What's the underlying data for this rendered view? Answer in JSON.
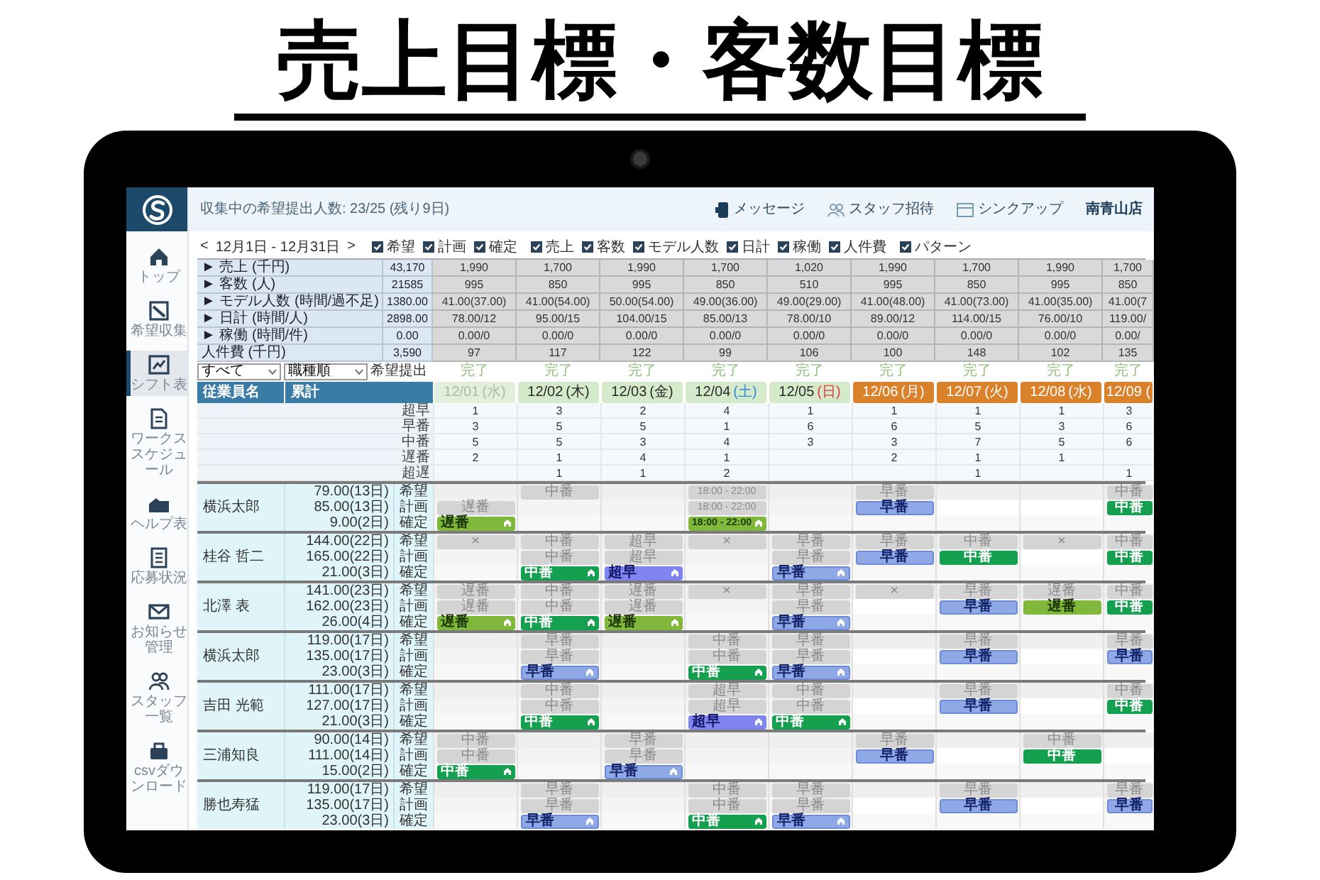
{
  "headline": "売上目標・客数目標",
  "header": {
    "status": "収集中の希望提出人数: 23/25 (残り9日)",
    "links": [
      "メッセージ",
      "スタッフ招待",
      "シンクアップ"
    ],
    "store": "南青山店"
  },
  "sidebar": {
    "items": [
      {
        "label": "トップ",
        "selected": false
      },
      {
        "label": "希望収集",
        "selected": false
      },
      {
        "label": "シフト表",
        "selected": true
      },
      {
        "label": "ワークススケジュール",
        "selected": false
      },
      {
        "label": "ヘルプ表",
        "selected": false
      },
      {
        "label": "応募状況",
        "selected": false
      },
      {
        "label": "お知らせ管理",
        "selected": false
      },
      {
        "label": "スタッフ一覧",
        "selected": false
      },
      {
        "label": "csvダウンロード",
        "selected": false
      }
    ]
  },
  "date_nav": {
    "prev": "<",
    "range": "12月1日 - 12月31日",
    "next": ">"
  },
  "toggles": [
    {
      "label": "希望",
      "checked": true
    },
    {
      "label": "計画",
      "checked": true
    },
    {
      "label": "確定",
      "checked": true
    },
    {
      "label": "売上",
      "checked": true
    },
    {
      "label": "客数",
      "checked": true
    },
    {
      "label": "モデル人数",
      "checked": true
    },
    {
      "label": "日計",
      "checked": true
    },
    {
      "label": "稼働",
      "checked": true
    },
    {
      "label": "人件費",
      "checked": true
    },
    {
      "label": "パターン",
      "checked": true
    }
  ],
  "summary": [
    {
      "label": "► 売上 (千円)",
      "total": "43,170",
      "values": [
        "1,990",
        "1,700",
        "1,990",
        "1,700",
        "1,020",
        "1,990",
        "1,700",
        "1,990",
        "1,700"
      ]
    },
    {
      "label": "► 客数 (人)",
      "total": "21585",
      "values": [
        "995",
        "850",
        "995",
        "850",
        "510",
        "995",
        "850",
        "995",
        "850"
      ]
    },
    {
      "label": "► モデル人数 (時間/過不足)",
      "total": "1380.00",
      "values": [
        "41.00(37.00)",
        "41.00(54.00)",
        "50.00(54.00)",
        "49.00(36.00)",
        "49.00(29.00)",
        "41.00(48.00)",
        "41.00(73.00)",
        "41.00(35.00)",
        "41.00(7"
      ]
    },
    {
      "label": "► 日計 (時間/人)",
      "total": "2898.00",
      "values": [
        "78.00/12",
        "95.00/15",
        "104.00/15",
        "85.00/13",
        "78.00/10",
        "89.00/12",
        "114.00/15",
        "76.00/10",
        "119.00/"
      ]
    },
    {
      "label": "► 稼働 (時間/件)",
      "total": "0.00",
      "values": [
        "0.00/0",
        "0.00/0",
        "0.00/0",
        "0.00/0",
        "0.00/0",
        "0.00/0",
        "0.00/0",
        "0.00/0",
        "0.00/"
      ]
    },
    {
      "label": "人件費 (千円)",
      "total": "3,590",
      "values": [
        "97",
        "117",
        "122",
        "99",
        "106",
        "100",
        "148",
        "102",
        "135"
      ]
    }
  ],
  "filters": {
    "selects": [
      "すべて",
      "職種順"
    ],
    "label": "希望提出"
  },
  "columns": [
    {
      "date": "12/01",
      "weekday": "(水)",
      "kind": "past",
      "status": "完了"
    },
    {
      "date": "12/02",
      "weekday": "(木)",
      "kind": "upcoming",
      "status": "完了"
    },
    {
      "date": "12/03",
      "weekday": "(金)",
      "kind": "upcoming",
      "status": "完了"
    },
    {
      "date": "12/04",
      "weekday": "(土)",
      "color": "#2b8ad8",
      "kind": "upcoming",
      "status": "完了"
    },
    {
      "date": "12/05",
      "weekday": "(日)",
      "color": "#e23b3b",
      "kind": "upcoming",
      "status": "完了"
    },
    {
      "date": "12/06",
      "weekday": "(月)",
      "kind": "open",
      "status": "完了"
    },
    {
      "date": "12/07",
      "weekday": "(火)",
      "kind": "open",
      "status": "完了"
    },
    {
      "date": "12/08",
      "weekday": "(水)",
      "kind": "open",
      "status": "完了"
    },
    {
      "date": "12/09 (",
      "kind": "open",
      "status": "完了"
    }
  ],
  "table_header": {
    "name": "従業員名",
    "total": "累計"
  },
  "shift_counts": [
    {
      "label": "超早",
      "values": [
        {
          "value": "1"
        },
        {
          "value": "3"
        },
        {
          "value": "2"
        },
        {
          "value": "4"
        },
        {
          "value": "1"
        },
        {
          "value": "1"
        },
        {
          "value": "1"
        },
        {
          "value": "1"
        },
        {
          "value": "3"
        }
      ]
    },
    {
      "label": "早番",
      "values": [
        {
          "value": "3"
        },
        {
          "value": "5"
        },
        {
          "value": "5"
        },
        {
          "value": "1"
        },
        {
          "value": "6"
        },
        {
          "value": "6"
        },
        {
          "value": "5"
        },
        {
          "value": "3"
        },
        {
          "value": "6"
        }
      ]
    },
    {
      "label": "中番",
      "values": [
        {
          "value": "5"
        },
        {
          "value": "5"
        },
        {
          "value": "3"
        },
        {
          "value": "4"
        },
        {
          "value": "3"
        },
        {
          "value": "3"
        },
        {
          "value": "7"
        },
        {
          "value": "5"
        },
        {
          "value": "6"
        }
      ]
    },
    {
      "label": "遅番",
      "values": [
        {
          "value": "2"
        },
        {
          "value": "1"
        },
        {
          "value": "4"
        },
        {
          "value": "1"
        },
        {
          "kind": "empty"
        },
        {
          "value": "2"
        },
        {
          "value": "1"
        },
        {
          "value": "1"
        },
        {
          "kind": "empty"
        }
      ]
    },
    {
      "label": "超遅",
      "values": [
        {
          "kind": "empty"
        },
        {
          "value": "1"
        },
        {
          "value": "1"
        },
        {
          "value": "2"
        },
        {
          "kind": "empty"
        },
        {
          "kind": "empty"
        },
        {
          "value": "1"
        },
        {
          "kind": "empty"
        },
        {
          "value": "1"
        }
      ]
    }
  ],
  "staff": [
    {
      "name": "横浜太郎",
      "rows": [
        {
          "label": "希望",
          "total": "79.00(13日)"
        },
        {
          "label": "計画",
          "total": "85.00(13日)"
        },
        {
          "label": "確定",
          "total": "9.00(2日)"
        }
      ],
      "days": [
        {
          "plan": {
            "kind": "gray",
            "label": "遅番"
          },
          "confirmed": {
            "kind": "olive",
            "label": "遅番"
          }
        },
        {
          "request": {
            "kind": "gray",
            "label": "中番"
          }
        },
        {
          "kind": "empty"
        },
        {
          "request": {
            "kind": "gray",
            "label": "18:00 - 22:00"
          },
          "plan": {
            "kind": "gray",
            "label": "18:00 - 22:00"
          },
          "confirmed": {
            "kind": "olive",
            "label": "18:00 - 22:00"
          }
        },
        {
          "kind": "empty"
        },
        {
          "request": {
            "kind": "gray",
            "label": "早番"
          },
          "plan": {
            "kind": "blue",
            "label": "早番"
          }
        },
        {
          "plan": {
            "kind": "blank"
          }
        },
        {
          "plan": {
            "kind": "blank"
          }
        },
        {
          "request": {
            "kind": "gray",
            "label": "中番"
          },
          "plan": {
            "kind": "green",
            "label": "中番"
          }
        }
      ]
    },
    {
      "name": "桂谷 哲二",
      "rows": [
        {
          "label": "希望",
          "total": "144.00(22日)"
        },
        {
          "label": "計画",
          "total": "165.00(22日)"
        },
        {
          "label": "確定",
          "total": "21.00(3日)"
        }
      ],
      "days": [
        {
          "request": {
            "kind": "gray",
            "label": "×"
          }
        },
        {
          "request": {
            "kind": "gray",
            "label": "中番"
          },
          "plan": {
            "kind": "gray",
            "label": "中番"
          },
          "confirmed": {
            "kind": "green",
            "label": "中番"
          }
        },
        {
          "request": {
            "kind": "gray",
            "label": "超早"
          },
          "plan": {
            "kind": "gray",
            "label": "超早"
          },
          "confirmed": {
            "kind": "purple",
            "label": "超早"
          }
        },
        {
          "request": {
            "kind": "gray",
            "label": "×"
          }
        },
        {
          "request": {
            "kind": "gray",
            "label": "早番"
          },
          "plan": {
            "kind": "gray",
            "label": "早番"
          },
          "confirmed": {
            "kind": "blue",
            "label": "早番"
          }
        },
        {
          "request": {
            "kind": "gray",
            "label": "早番"
          },
          "plan": {
            "kind": "blue",
            "label": "早番"
          }
        },
        {
          "request": {
            "kind": "gray",
            "label": "中番"
          },
          "plan": {
            "kind": "green",
            "label": "中番"
          }
        },
        {
          "request": {
            "kind": "gray",
            "label": "×"
          },
          "plan": {
            "kind": "blank"
          }
        },
        {
          "request": {
            "kind": "gray",
            "label": "中番"
          },
          "plan": {
            "kind": "green",
            "label": "中番"
          }
        }
      ]
    },
    {
      "name": "北澤 表",
      "rows": [
        {
          "label": "希望",
          "total": "141.00(23日)"
        },
        {
          "label": "計画",
          "total": "162.00(23日)"
        },
        {
          "label": "確定",
          "total": "26.00(4日)"
        }
      ],
      "days": [
        {
          "request": {
            "kind": "gray",
            "label": "遅番"
          },
          "plan": {
            "kind": "gray",
            "label": "遅番"
          },
          "confirmed": {
            "kind": "olive",
            "label": "遅番"
          }
        },
        {
          "request": {
            "kind": "gray",
            "label": "中番"
          },
          "plan": {
            "kind": "gray",
            "label": "中番"
          },
          "confirmed": {
            "kind": "green",
            "label": "中番"
          }
        },
        {
          "request": {
            "kind": "gray",
            "label": "遅番"
          },
          "plan": {
            "kind": "gray",
            "label": "遅番"
          },
          "confirmed": {
            "kind": "olive",
            "label": "遅番"
          }
        },
        {
          "request": {
            "kind": "gray",
            "label": "×"
          }
        },
        {
          "request": {
            "kind": "gray",
            "label": "早番"
          },
          "plan": {
            "kind": "gray",
            "label": "早番"
          },
          "confirmed": {
            "kind": "blue",
            "label": "早番"
          }
        },
        {
          "request": {
            "kind": "gray",
            "label": "×"
          },
          "plan": {
            "kind": "blank"
          }
        },
        {
          "request": {
            "kind": "gray",
            "label": "早番"
          },
          "plan": {
            "kind": "blue",
            "label": "早番"
          }
        },
        {
          "request": {
            "kind": "gray",
            "label": "遅番"
          },
          "plan": {
            "kind": "olive",
            "label": "遅番"
          }
        },
        {
          "request": {
            "kind": "gray",
            "label": "中番"
          },
          "plan": {
            "kind": "green",
            "label": "中番"
          }
        }
      ]
    },
    {
      "name": "横浜太郎",
      "rows": [
        {
          "label": "希望",
          "total": "119.00(17日)"
        },
        {
          "label": "計画",
          "total": "135.00(17日)"
        },
        {
          "label": "確定",
          "total": "23.00(3日)"
        }
      ],
      "days": [
        {
          "kind": "empty"
        },
        {
          "request": {
            "kind": "gray",
            "label": "早番"
          },
          "plan": {
            "kind": "gray",
            "label": "早番"
          },
          "confirmed": {
            "kind": "blue",
            "label": "早番"
          }
        },
        {
          "kind": "empty"
        },
        {
          "request": {
            "kind": "gray",
            "label": "中番"
          },
          "plan": {
            "kind": "gray",
            "label": "中番"
          },
          "confirmed": {
            "kind": "green",
            "label": "中番"
          }
        },
        {
          "request": {
            "kind": "gray",
            "label": "早番"
          },
          "plan": {
            "kind": "gray",
            "label": "早番"
          },
          "confirmed": {
            "kind": "blue",
            "label": "早番"
          }
        },
        {
          "plan": {
            "kind": "blank"
          }
        },
        {
          "request": {
            "kind": "gray",
            "label": "早番"
          },
          "plan": {
            "kind": "blue",
            "label": "早番"
          }
        },
        {
          "plan": {
            "kind": "blank"
          }
        },
        {
          "request": {
            "kind": "gray",
            "label": "早番"
          },
          "plan": {
            "kind": "blue",
            "label": "早番"
          }
        }
      ]
    },
    {
      "name": "吉田 光範",
      "rows": [
        {
          "label": "希望",
          "total": "111.00(17日)"
        },
        {
          "label": "計画",
          "total": "127.00(17日)"
        },
        {
          "label": "確定",
          "total": "21.00(3日)"
        }
      ],
      "days": [
        {
          "kind": "empty"
        },
        {
          "request": {
            "kind": "gray",
            "label": "中番"
          },
          "plan": {
            "kind": "gray",
            "label": "中番"
          },
          "confirmed": {
            "kind": "green",
            "label": "中番"
          }
        },
        {
          "kind": "empty"
        },
        {
          "request": {
            "kind": "gray",
            "label": "超早"
          },
          "plan": {
            "kind": "gray",
            "label": "超早"
          },
          "confirmed": {
            "kind": "purple",
            "label": "超早"
          }
        },
        {
          "request": {
            "kind": "gray",
            "label": "中番"
          },
          "plan": {
            "kind": "gray",
            "label": "中番"
          },
          "confirmed": {
            "kind": "green",
            "label": "中番"
          }
        },
        {
          "plan": {
            "kind": "blank"
          }
        },
        {
          "request": {
            "kind": "gray",
            "label": "早番"
          },
          "plan": {
            "kind": "blue",
            "label": "早番"
          }
        },
        {
          "plan": {
            "kind": "blank"
          }
        },
        {
          "request": {
            "kind": "gray",
            "label": "中番"
          },
          "plan": {
            "kind": "green",
            "label": "中番"
          }
        }
      ]
    },
    {
      "name": "三浦知良",
      "rows": [
        {
          "label": "希望",
          "total": "90.00(14日)"
        },
        {
          "label": "計画",
          "total": "111.00(14日)"
        },
        {
          "label": "確定",
          "total": "15.00(2日)"
        }
      ],
      "days": [
        {
          "request": {
            "kind": "gray",
            "label": "中番"
          },
          "plan": {
            "kind": "gray",
            "label": "中番"
          },
          "confirmed": {
            "kind": "green",
            "label": "中番"
          }
        },
        {
          "kind": "empty"
        },
        {
          "request": {
            "kind": "gray",
            "label": "早番"
          },
          "plan": {
            "kind": "gray",
            "label": "早番"
          },
          "confirmed": {
            "kind": "blue",
            "label": "早番"
          }
        },
        {
          "kind": "empty"
        },
        {
          "kind": "empty"
        },
        {
          "request": {
            "kind": "gray",
            "label": "早番"
          },
          "plan": {
            "kind": "blue",
            "label": "早番"
          }
        },
        {
          "plan": {
            "kind": "blank"
          }
        },
        {
          "request": {
            "kind": "gray",
            "label": "中番"
          },
          "plan": {
            "kind": "green",
            "label": "中番"
          }
        },
        {
          "plan": {
            "kind": "blank"
          }
        }
      ]
    },
    {
      "name": "勝也寿猛",
      "rows": [
        {
          "label": "希望",
          "total": "119.00(17日)"
        },
        {
          "label": "計画",
          "total": "135.00(17日)"
        },
        {
          "label": "確定",
          "total": "23.00(3日)"
        }
      ],
      "days": [
        {
          "kind": "empty"
        },
        {
          "request": {
            "kind": "gray",
            "label": "早番"
          },
          "plan": {
            "kind": "gray",
            "label": "早番"
          },
          "confirmed": {
            "kind": "blue",
            "label": "早番"
          }
        },
        {
          "kind": "empty"
        },
        {
          "request": {
            "kind": "gray",
            "label": "中番"
          },
          "plan": {
            "kind": "gray",
            "label": "中番"
          },
          "confirmed": {
            "kind": "green",
            "label": "中番"
          }
        },
        {
          "request": {
            "kind": "gray",
            "label": "早番"
          },
          "plan": {
            "kind": "gray",
            "label": "早番"
          },
          "confirmed": {
            "kind": "blue",
            "label": "早番"
          }
        },
        {
          "plan": {
            "kind": "blank"
          }
        },
        {
          "request": {
            "kind": "gray",
            "label": "早番"
          },
          "plan": {
            "kind": "blue",
            "label": "早番"
          }
        },
        {
          "plan": {
            "kind": "blank"
          }
        },
        {
          "request": {
            "kind": "gray",
            "label": "早番"
          },
          "plan": {
            "kind": "blue",
            "label": "早番"
          }
        }
      ]
    }
  ]
}
